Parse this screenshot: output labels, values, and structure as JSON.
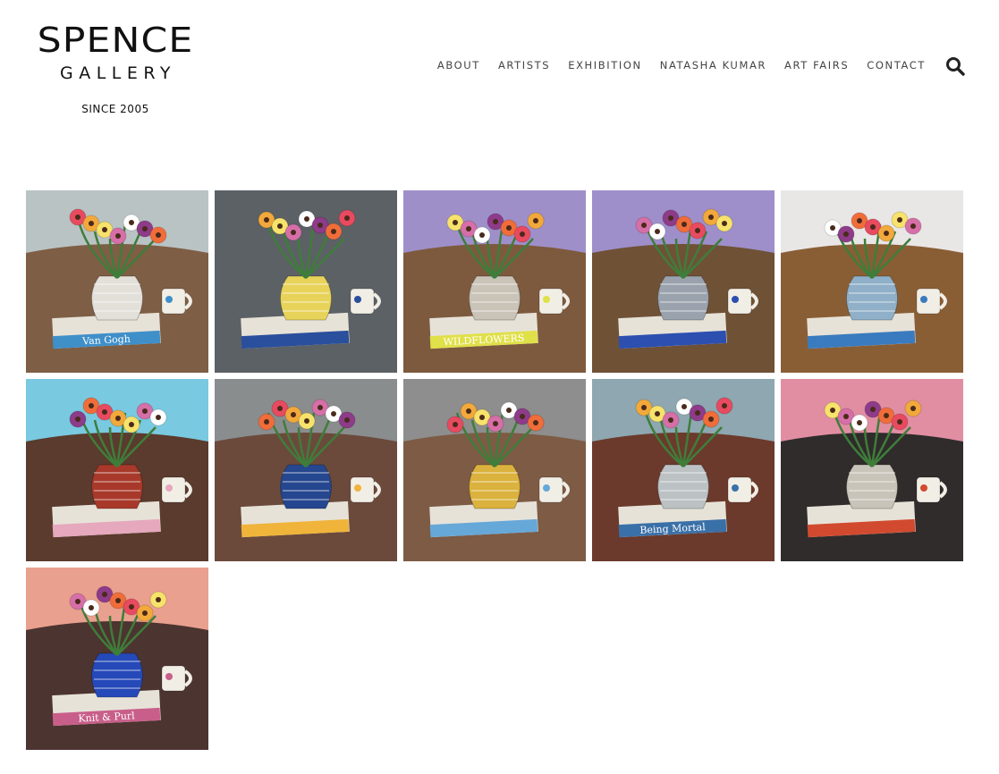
{
  "logo": {
    "line1": "SPENCE",
    "line2": "GALLERY",
    "since": "SINCE 2005"
  },
  "nav": {
    "items": [
      "ABOUT",
      "ARTISTS",
      "EXHIBITION",
      "NATASHA KUMAR",
      "ART FAIRS",
      "CONTACT"
    ]
  },
  "search": {
    "icon": "search-icon"
  },
  "artworks": [
    {
      "name": "still-life-van-gogh-book",
      "bg": "#7e5e45",
      "wall": "#b9c3c4",
      "vase": "#e3e0da",
      "accent": "#3f8fc9",
      "book_label": "Van Gogh"
    },
    {
      "name": "still-life-floral-vases",
      "bg": "#5c6166",
      "wall": "#5c6166",
      "vase": "#e8d35a",
      "accent": "#2a4f9c",
      "book_label": ""
    },
    {
      "name": "still-life-striped-jug",
      "bg": "#7d5a3e",
      "wall": "#9f8fc9",
      "vase": "#c9c3b8",
      "accent": "#e0e048",
      "book_label": "WILDFLOWERS"
    },
    {
      "name": "still-life-french-press",
      "bg": "#6f5136",
      "wall": "#9e8fca",
      "vase": "#9aa3ad",
      "accent": "#2c4fb0",
      "book_label": ""
    },
    {
      "name": "still-life-open-book-flowers",
      "bg": "#8a5e35",
      "wall": "#e9e6e6",
      "vase": "#8fb0c8",
      "accent": "#3a7bbf",
      "book_label": ""
    },
    {
      "name": "still-life-pink-flower",
      "bg": "#5a3b2d",
      "wall": "#79c9e0",
      "vase": "#a8392a",
      "accent": "#e5a8bd",
      "book_label": ""
    },
    {
      "name": "still-life-blue-bottles",
      "bg": "#6b4a3c",
      "wall": "#8a8d8e",
      "vase": "#25478f",
      "accent": "#f0b43a",
      "book_label": ""
    },
    {
      "name": "still-life-yellow-teapot",
      "bg": "#7d5b45",
      "wall": "#8d8e8d",
      "vase": "#dbb23d",
      "accent": "#66a8d8",
      "book_label": ""
    },
    {
      "name": "still-life-being-mortal",
      "bg": "#6b3a2c",
      "wall": "#8ea7b0",
      "vase": "#bcc2c4",
      "accent": "#3a70a8",
      "book_label": "Being Mortal"
    },
    {
      "name": "still-life-sunflower-pink-wall",
      "bg": "#2f2c2b",
      "wall": "#e18ea3",
      "vase": "#c9c4b9",
      "accent": "#d14a2f",
      "book_label": ""
    },
    {
      "name": "still-life-blue-jug-knit-purl",
      "bg": "#4c3430",
      "wall": "#e9a08e",
      "vase": "#2549b8",
      "accent": "#c85f8a",
      "book_label": "Knit & Purl"
    }
  ]
}
